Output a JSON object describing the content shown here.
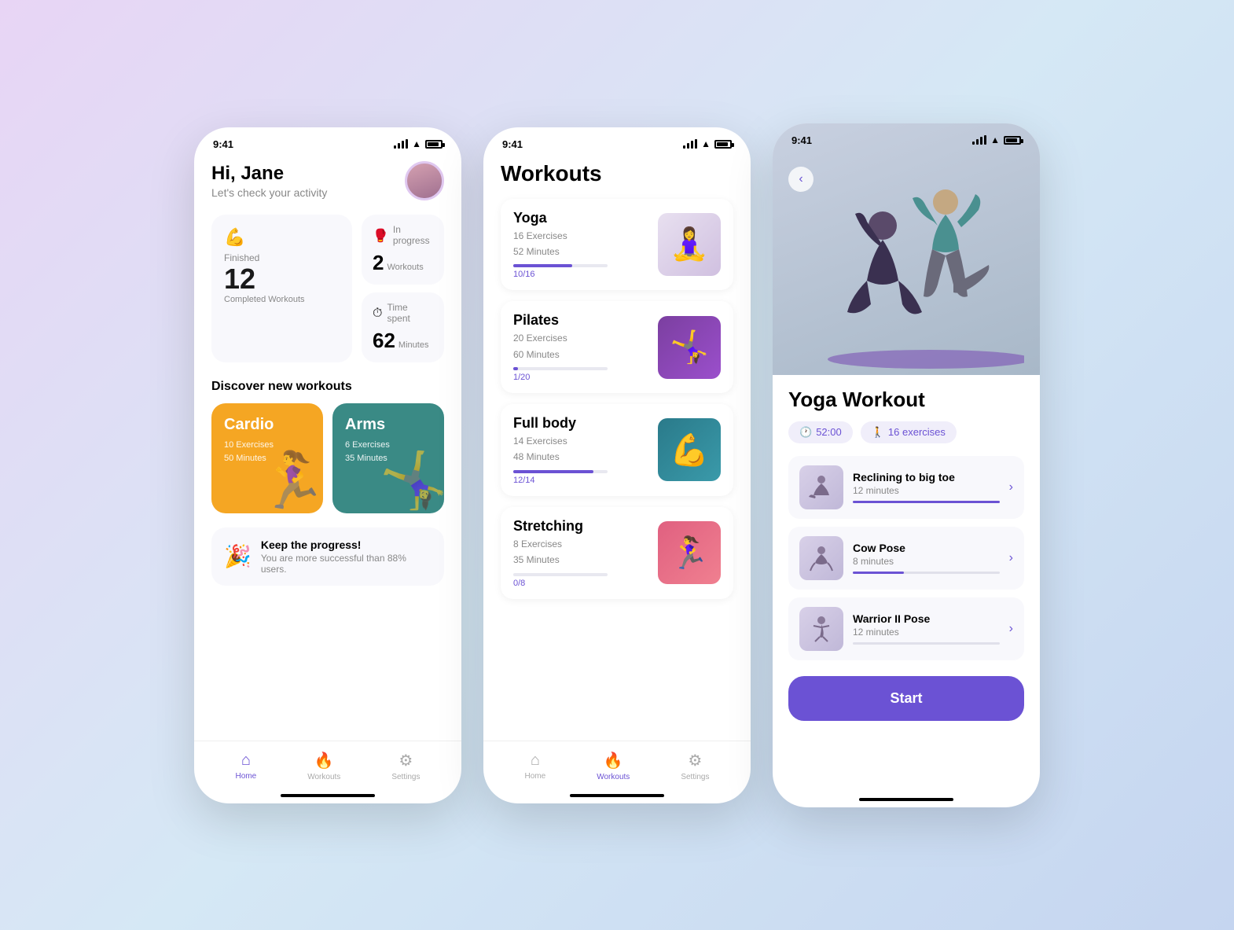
{
  "app": {
    "status_time": "9:41"
  },
  "home_screen": {
    "greeting": "Hi, Jane",
    "subtitle": "Let's check your activity",
    "stats": {
      "finished_label": "Finished",
      "finished_emoji": "💪",
      "finished_number": "12",
      "finished_sublabel": "Completed Workouts",
      "inprogress_label": "In progress",
      "inprogress_emoji": "🥊",
      "inprogress_number": "2",
      "inprogress_sublabel": "Workouts",
      "timespent_label": "Time spent",
      "timespent_emoji": "⏱",
      "timespent_number": "62",
      "timespent_sublabel": "Minutes"
    },
    "discover_title": "Discover new workouts",
    "cards": [
      {
        "title": "Cardio",
        "exercises": "10 Exercises",
        "duration": "50 Minutes",
        "color": "yellow"
      },
      {
        "title": "Arms",
        "exercises": "6 Exercises",
        "duration": "35 Minutes",
        "color": "teal"
      }
    ],
    "banner": {
      "title": "Keep the progress!",
      "subtitle": "You are more successful than 88% users.",
      "emoji": "🎉"
    },
    "nav": {
      "home": "Home",
      "workouts": "Workouts",
      "settings": "Settings"
    }
  },
  "workouts_screen": {
    "title": "Workouts",
    "items": [
      {
        "name": "Yoga",
        "exercises": "16 Exercises",
        "duration": "52 Minutes",
        "progress_label": "10/16",
        "progress_pct": 62
      },
      {
        "name": "Pilates",
        "exercises": "20 Exercises",
        "duration": "60 Minutes",
        "progress_label": "1/20",
        "progress_pct": 5
      },
      {
        "name": "Full body",
        "exercises": "14 Exercises",
        "duration": "48 Minutes",
        "progress_label": "12/14",
        "progress_pct": 85
      },
      {
        "name": "Stretching",
        "exercises": "8 Exercises",
        "duration": "35 Minutes",
        "progress_label": "0/8",
        "progress_pct": 0
      }
    ],
    "nav": {
      "home": "Home",
      "workouts": "Workouts",
      "settings": "Settings"
    }
  },
  "yoga_detail_screen": {
    "title": "Yoga Workout",
    "time_badge": "52:00",
    "exercises_badge": "16 exercises",
    "exercises": [
      {
        "name": "Reclining to big toe",
        "duration": "12 minutes",
        "progress_pct": 100
      },
      {
        "name": "Cow Pose",
        "duration": "8 minutes",
        "progress_pct": 35
      },
      {
        "name": "Warrior II Pose",
        "duration": "12 minutes",
        "progress_pct": 0
      }
    ],
    "start_button": "Start",
    "back_button": "‹"
  },
  "icons": {
    "home": "⌂",
    "workouts": "🔥",
    "settings": "⚙",
    "time": "🕐",
    "person": "🚶",
    "chevron_right": "›",
    "chevron_left": "‹",
    "signal": "signal",
    "wifi": "wifi",
    "battery": "battery"
  }
}
